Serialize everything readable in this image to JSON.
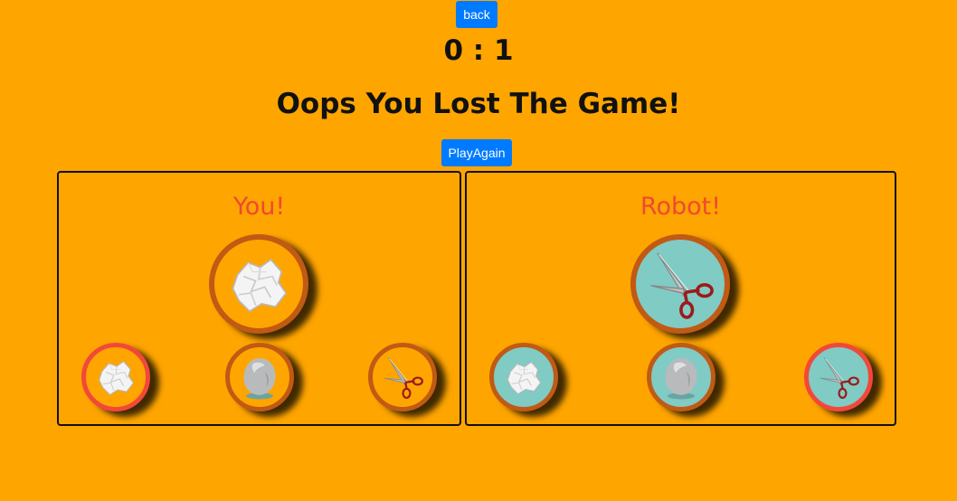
{
  "header": {
    "back_label": "back",
    "score": "0 : 1",
    "result_message": "Oops You Lost The Game!",
    "play_again_label": "PlayAgain"
  },
  "player": {
    "title": "You!",
    "selected": "paper-icon",
    "choices": [
      {
        "icon": "paper-icon",
        "highlighted": true
      },
      {
        "icon": "rock-icon",
        "highlighted": false
      },
      {
        "icon": "scissors-icon",
        "highlighted": false
      }
    ]
  },
  "robot": {
    "title": "Robot!",
    "selected": "scissors-icon",
    "choices": [
      {
        "icon": "paper-icon",
        "highlighted": false
      },
      {
        "icon": "rock-icon",
        "highlighted": false
      },
      {
        "icon": "scissors-icon",
        "highlighted": true
      }
    ]
  },
  "colors": {
    "background": "#ffa500",
    "button": "#007bff",
    "title": "#f0492f",
    "ring": "#c05a14",
    "highlight_ring": "#f2483a",
    "robot_fill": "#80cbc4"
  }
}
